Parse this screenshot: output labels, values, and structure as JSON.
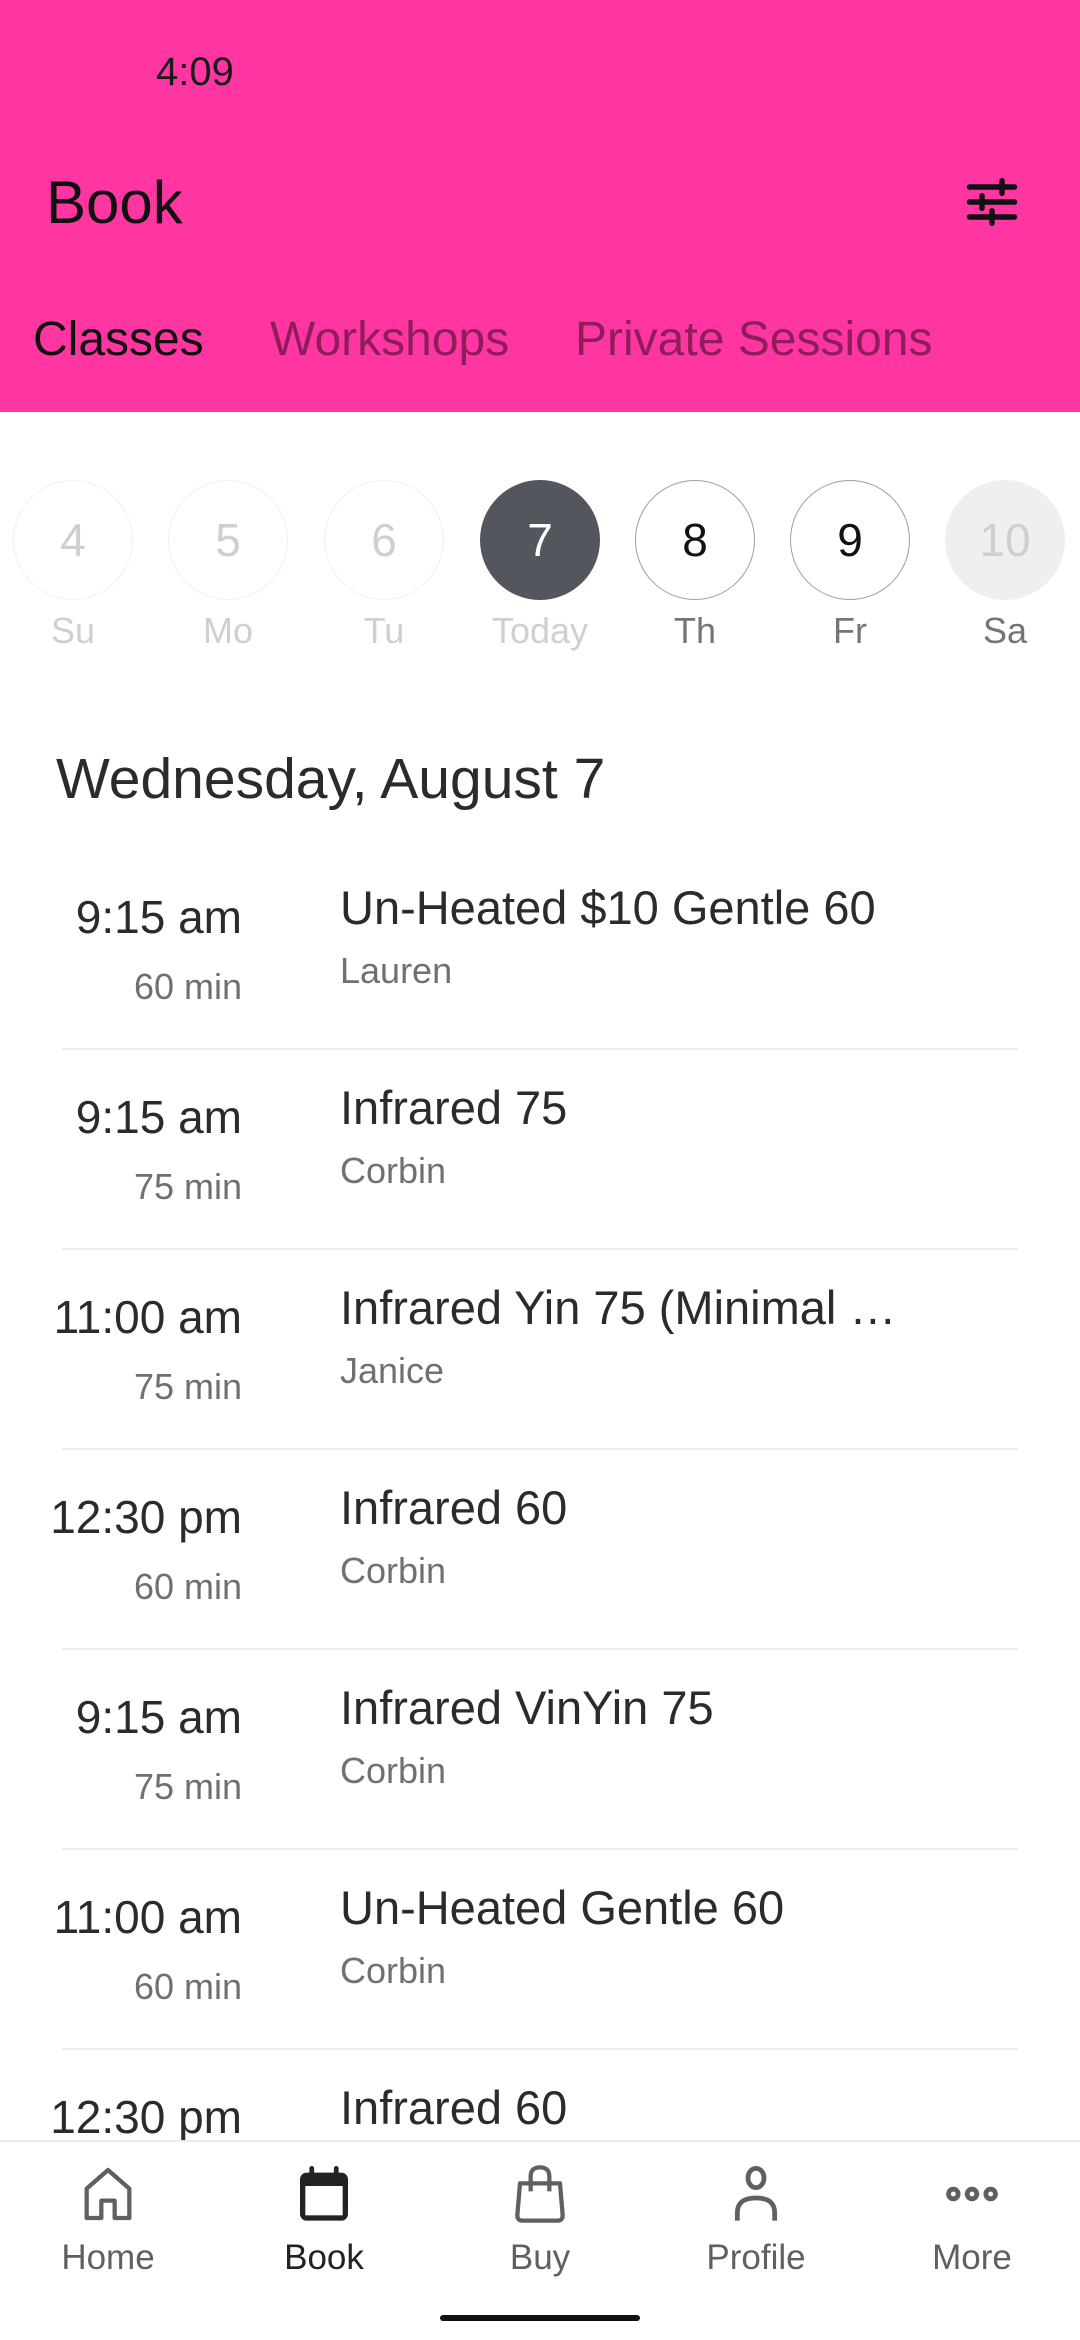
{
  "status_bar": {
    "time": "4:09"
  },
  "header": {
    "title": "Book",
    "filter_icon": "sliders-icon",
    "background": "#ff36a2",
    "tabs": [
      {
        "label": "Classes",
        "active": true
      },
      {
        "label": "Workshops",
        "active": false
      },
      {
        "label": "Private Sessions",
        "active": false
      }
    ]
  },
  "date_strip": [
    {
      "day": "4",
      "label": "Su",
      "state": "past"
    },
    {
      "day": "5",
      "label": "Mo",
      "state": "past"
    },
    {
      "day": "6",
      "label": "Tu",
      "state": "past"
    },
    {
      "day": "7",
      "label": "Today",
      "state": "today"
    },
    {
      "day": "8",
      "label": "Th",
      "state": "future"
    },
    {
      "day": "9",
      "label": "Fr",
      "state": "future"
    },
    {
      "day": "10",
      "label": "Sa",
      "state": "disabled"
    }
  ],
  "schedule": {
    "heading": "Wednesday, August 7",
    "classes": [
      {
        "time": "9:15 am",
        "duration": "60 min",
        "name": "Un-Heated $10 Gentle 60",
        "instructor": "Lauren"
      },
      {
        "time": "9:15 am",
        "duration": "75 min",
        "name": "Infrared 75",
        "instructor": "Corbin"
      },
      {
        "time": "11:00 am",
        "duration": "75 min",
        "name": "Infrared Yin 75 (Minimal I…",
        "instructor": "Janice"
      },
      {
        "time": "12:30 pm",
        "duration": "60 min",
        "name": "Infrared 60",
        "instructor": "Corbin"
      },
      {
        "time": "9:15 am",
        "duration": "75 min",
        "name": "Infrared VinYin 75",
        "instructor": "Corbin"
      },
      {
        "time": "11:00 am",
        "duration": "60 min",
        "name": "Un-Heated Gentle 60",
        "instructor": "Corbin"
      },
      {
        "time": "12:30 pm",
        "duration": "",
        "name": "Infrared 60",
        "instructor": ""
      }
    ]
  },
  "bottom_nav": [
    {
      "label": "Home",
      "icon": "home-icon",
      "active": false
    },
    {
      "label": "Book",
      "icon": "calendar-icon",
      "active": true
    },
    {
      "label": "Buy",
      "icon": "shopping-bag-icon",
      "active": false
    },
    {
      "label": "Profile",
      "icon": "person-icon",
      "active": false
    },
    {
      "label": "More",
      "icon": "more-horizontal-icon",
      "active": false
    }
  ]
}
